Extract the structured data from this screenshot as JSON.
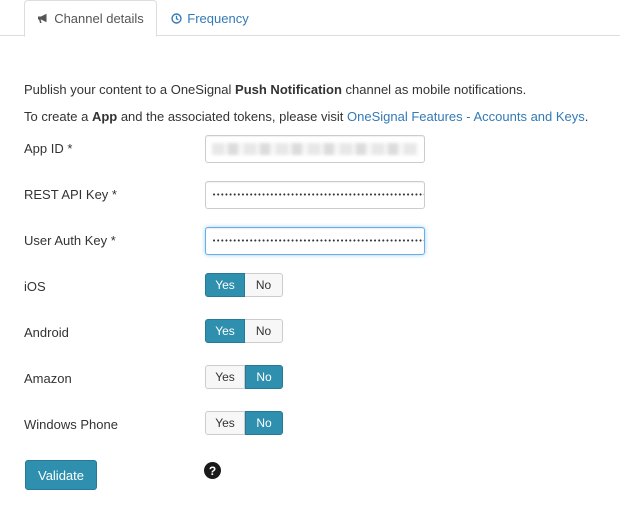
{
  "tabs": {
    "channel_details": "Channel details",
    "frequency": "Frequency",
    "channel_icon": "megaphone-icon",
    "frequency_icon": "clock-icon"
  },
  "intro": {
    "line1_pre": "Publish your content to a OneSignal ",
    "line1_bold": "Push Notification",
    "line1_post": " channel as mobile notifications.",
    "line2_pre": "To create a ",
    "line2_bold": "App",
    "line2_mid": " and the associated tokens, please visit ",
    "line2_link": "OneSignal Features - Accounts and Keys",
    "line2_post": "."
  },
  "fields": {
    "app_id": {
      "label": "App ID  *"
    },
    "rest_api_key": {
      "label": "REST API Key  *",
      "value": "••••••••••••••••••••••••••••••••••••••••••••••••••••"
    },
    "user_auth_key": {
      "label": "User Auth Key  *",
      "value": "••••••••••••••••••••••••••••••••••••••••••••••••••••"
    }
  },
  "toggles": {
    "yes_label": "Yes",
    "no_label": "No",
    "ios": {
      "label": "iOS",
      "selected": "Yes"
    },
    "android": {
      "label": "Android",
      "selected": "Yes"
    },
    "amazon": {
      "label": "Amazon",
      "selected": "No"
    },
    "windows_phone": {
      "label": "Windows Phone",
      "selected": "No"
    }
  },
  "actions": {
    "validate_label": "Validate",
    "help_icon": "question-circle-icon",
    "help_glyph": "?"
  },
  "colors": {
    "accent": "#2e8fae",
    "link": "#337ab7"
  }
}
